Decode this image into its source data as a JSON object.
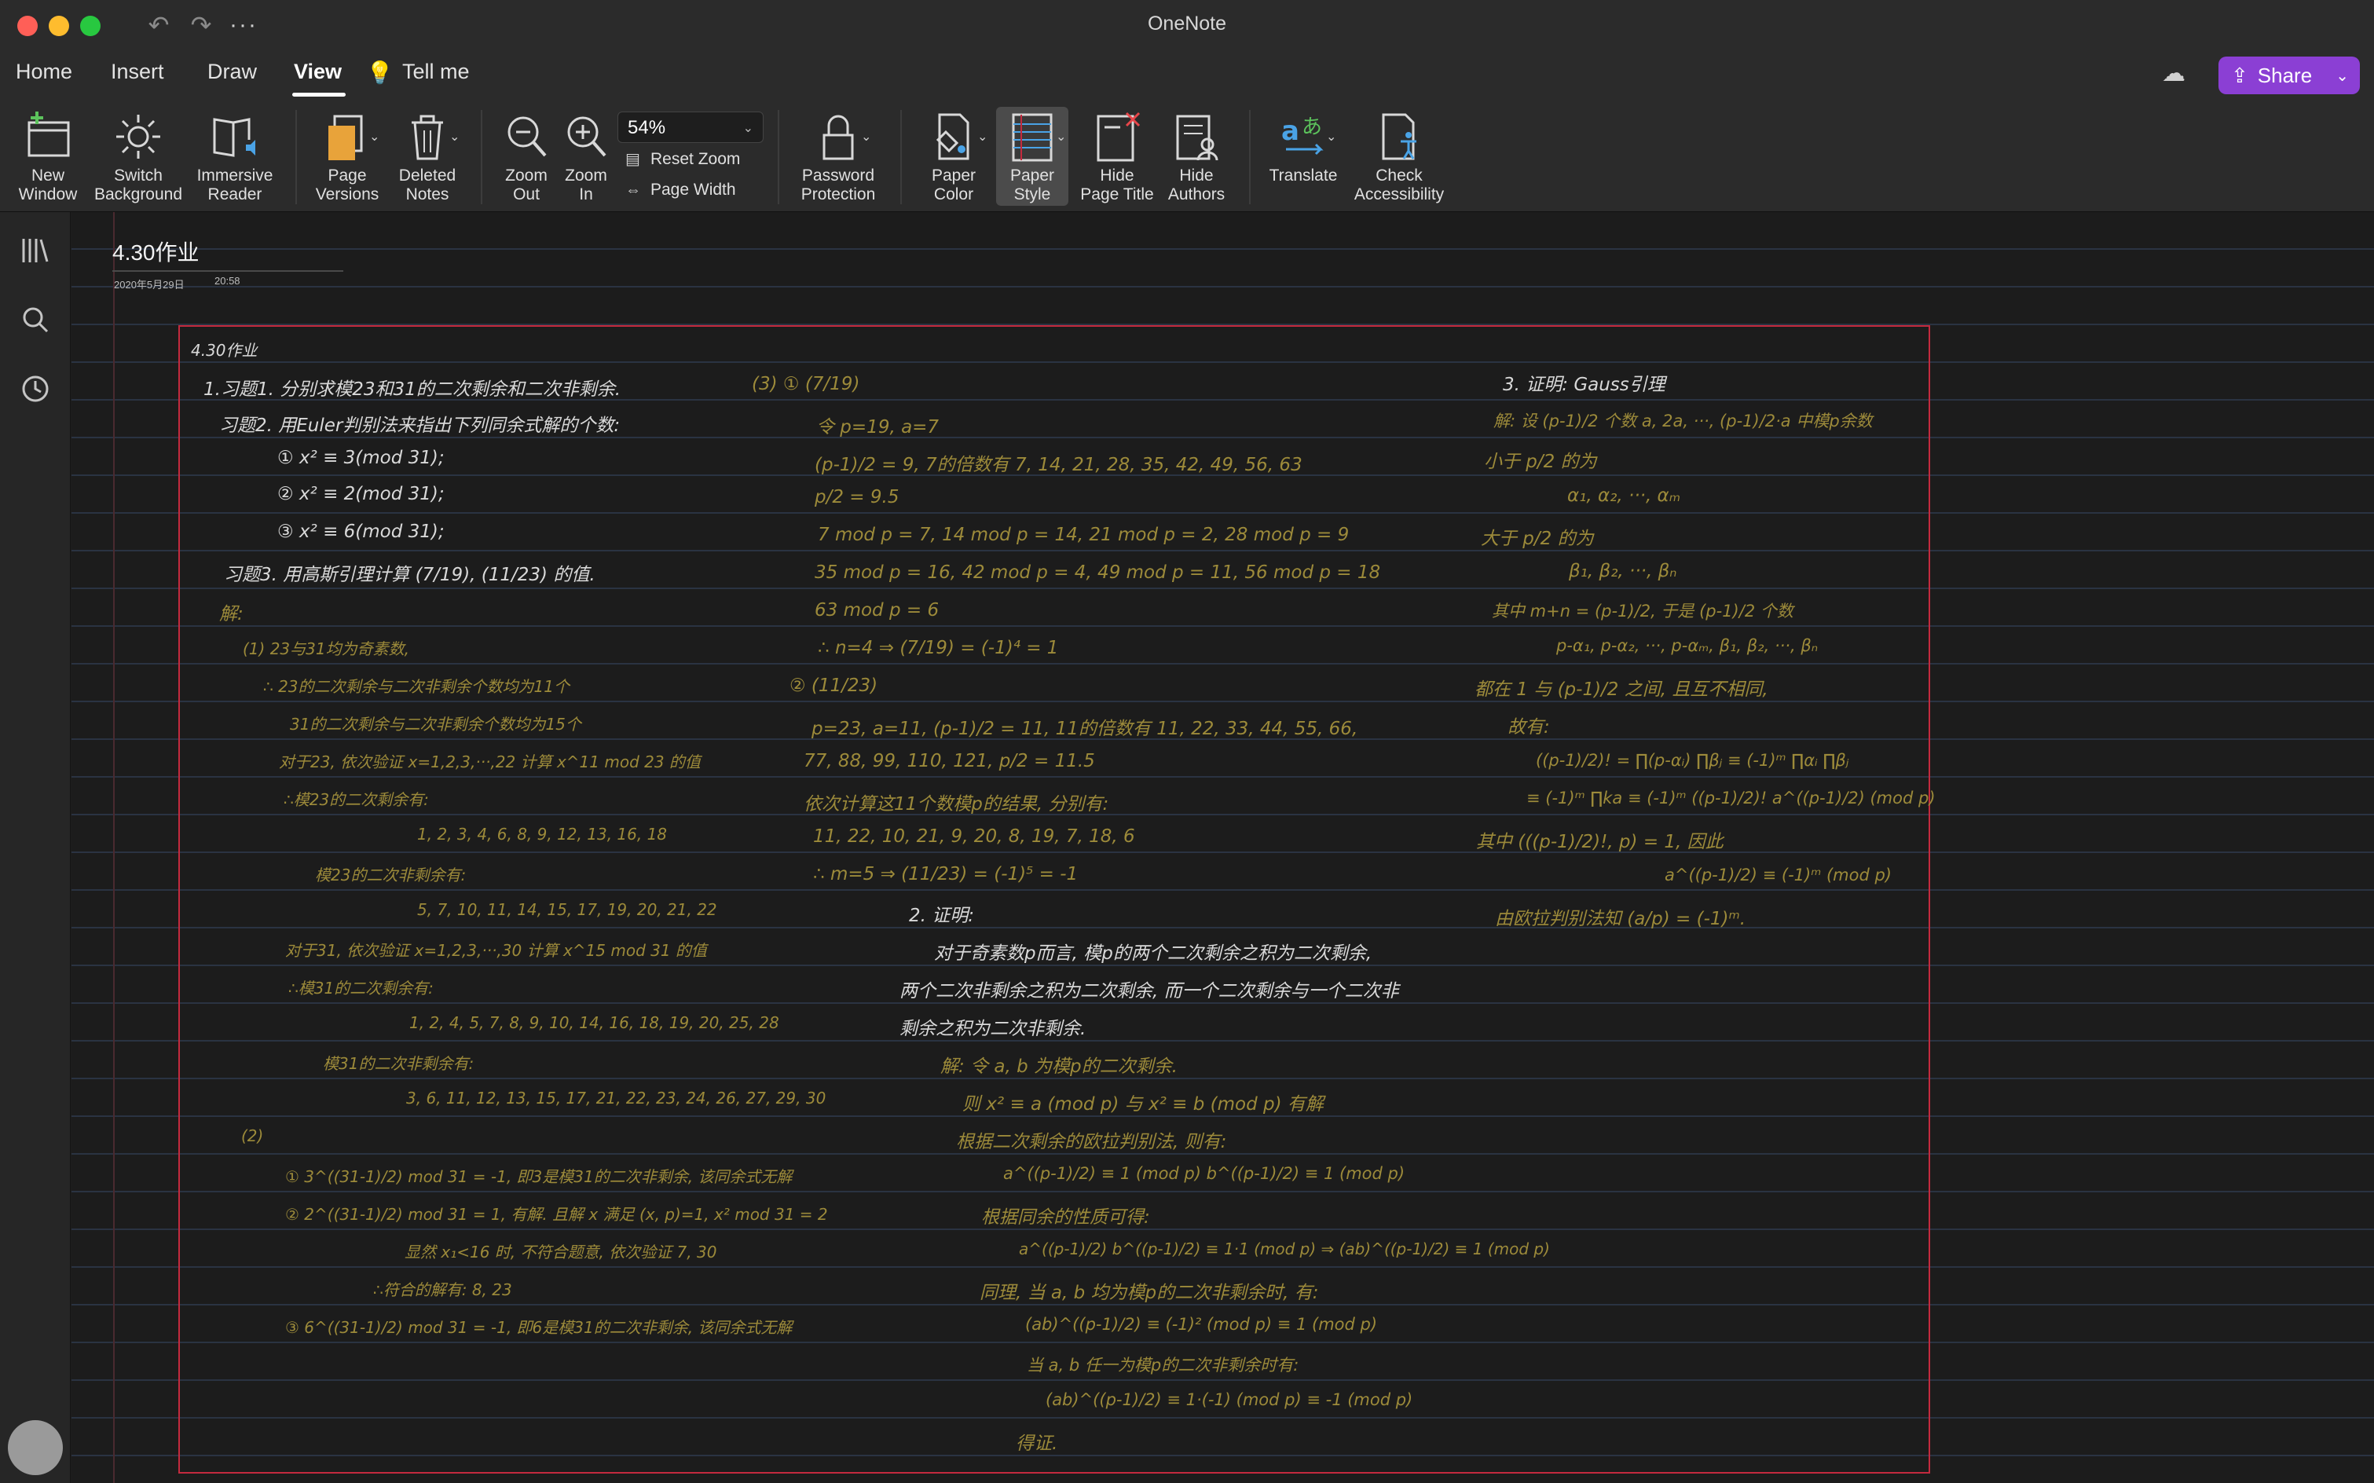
{
  "window": {
    "title": "OneNote",
    "more_label": "···"
  },
  "menu": {
    "tabs": [
      "Home",
      "Insert",
      "Draw",
      "View",
      "Tell me"
    ],
    "active": "View",
    "share_label": "Share"
  },
  "ribbon": {
    "new_window": "New\nWindow",
    "switch_background": "Switch\nBackground",
    "immersive_reader": "Immersive\nReader",
    "page_versions": "Page\nVersions",
    "deleted_notes": "Deleted\nNotes",
    "zoom_out": "Zoom\nOut",
    "zoom_in": "Zoom\nIn",
    "zoom_value": "54%",
    "reset_zoom": "Reset Zoom",
    "page_width": "Page Width",
    "password_protection": "Password\nProtection",
    "paper_color": "Paper\nColor",
    "paper_style": "Paper\nStyle",
    "hide_page_title": "Hide\nPage Title",
    "hide_authors": "Hide\nAuthors",
    "translate": "Translate",
    "check_accessibility": "Check\nAccessibility"
  },
  "page": {
    "title": "4.30作业",
    "date": "2020年5月29日",
    "time": "20:58"
  },
  "ink": {
    "col1": [
      "4.30作业",
      "1.习题1. 分别求模23和31的二次剩余和二次非剩余.",
      "习题2. 用Euler判别法来指出下列同余式解的个数:",
      "① x² ≡ 3(mod 31);",
      "② x² ≡ 2(mod 31);",
      "③ x² ≡ 6(mod 31);",
      "习题3. 用高斯引理计算 (7/19), (11/23) 的值.",
      "解:",
      "(1) 23与31均为奇素数,",
      "∴ 23的二次剩余与二次非剩余个数均为11个",
      "31的二次剩余与二次非剩余个数均为15个",
      "对于23, 依次验证 x=1,2,3,···,22 计算 x^11 mod 23 的值",
      "∴模23的二次剩余有:",
      "1, 2, 3, 4, 6, 8, 9, 12, 13, 16, 18",
      "模23的二次非剩余有:",
      "5, 7, 10, 11, 14, 15, 17, 19, 20, 21, 22",
      "对于31, 依次验证 x=1,2,3,···,30 计算 x^15 mod 31 的值",
      "∴模31的二次剩余有:",
      "1, 2, 4, 5, 7, 8, 9, 10, 14, 16, 18, 19, 20, 25, 28",
      "模31的二次非剩余有:",
      "3, 6, 11, 12, 13, 15, 17, 21, 22, 23, 24, 26, 27, 29, 30",
      "(2)",
      "① 3^((31-1)/2) mod 31 = -1, 即3是模31的二次非剩余, 该同余式无解",
      "② 2^((31-1)/2) mod 31 = 1, 有解. 且解 x 满足 (x, p)=1, x² mod 31 = 2",
      "显然 x₁<16 时, 不符合题意, 依次验证 7, 30",
      "∴符合的解有: 8, 23",
      "③ 6^((31-1)/2) mod 31 = -1, 即6是模31的二次非剩余, 该同余式无解"
    ],
    "col2": [
      "(3) ① (7/19)",
      "令 p=19, a=7",
      "(p-1)/2 = 9, 7的倍数有 7, 14, 21, 28, 35, 42, 49, 56, 63",
      "p/2 = 9.5",
      "7 mod p = 7, 14 mod p = 14, 21 mod p = 2, 28 mod p = 9",
      "35 mod p = 16, 42 mod p = 4, 49 mod p = 11, 56 mod p = 18",
      "63 mod p = 6",
      "∴ n=4 ⇒ (7/19) = (-1)⁴ = 1",
      "② (11/23)",
      "p=23, a=11, (p-1)/2 = 11, 11的倍数有 11, 22, 33, 44, 55, 66,",
      "77, 88, 99, 110, 121, p/2 = 11.5",
      "依次计算这11个数模p的结果, 分别有:",
      "11, 22, 10, 21, 9, 20, 8, 19, 7, 18, 6",
      "∴ m=5 ⇒ (11/23) = (-1)⁵ = -1",
      "2. 证明:",
      "对于奇素数p而言, 模p的两个二次剩余之积为二次剩余,",
      "两个二次非剩余之积为二次剩余, 而一个二次剩余与一个二次非",
      "剩余之积为二次非剩余.",
      "解: 令 a, b 为模p的二次剩余.",
      "则 x² ≡ a (mod p) 与 x² ≡ b (mod p) 有解",
      "根据二次剩余的欧拉判别法, 则有:",
      "a^((p-1)/2) ≡ 1 (mod p)    b^((p-1)/2) ≡ 1 (mod p)",
      "根据同余的性质可得:",
      "a^((p-1)/2) b^((p-1)/2) ≡ 1·1 (mod p) ⇒ (ab)^((p-1)/2) ≡ 1 (mod p)",
      "同理, 当 a, b 均为模p的二次非剩余时, 有:",
      "(ab)^((p-1)/2) ≡ (-1)² (mod p) ≡ 1 (mod p)",
      "当 a, b 任一为模p的二次非剩余时有:",
      "(ab)^((p-1)/2) ≡ 1·(-1) (mod p) ≡ -1 (mod p)",
      "得证."
    ],
    "col3": [
      "3. 证明: Gauss引理",
      "解: 设 (p-1)/2 个数 a, 2a, ···, (p-1)/2·a 中模p余数",
      "小于 p/2 的为",
      "α₁, α₂, ···, αₘ",
      "大于 p/2 的为",
      "β₁, β₂, ···, βₙ",
      "其中 m+n = (p-1)/2, 于是 (p-1)/2 个数",
      "p-α₁, p-α₂, ···, p-αₘ, β₁, β₂, ···, βₙ",
      "都在 1 与 (p-1)/2 之间, 且互不相同,",
      "故有:",
      "((p-1)/2)! = ∏(p-αᵢ) ∏βⱼ ≡ (-1)ᵐ ∏αᵢ ∏βⱼ",
      "≡ (-1)ᵐ ∏ka ≡ (-1)ᵐ ((p-1)/2)! a^((p-1)/2) (mod p)",
      "其中 (((p-1)/2)!, p) = 1, 因此",
      "a^((p-1)/2) ≡ (-1)ᵐ (mod p)",
      "由欧拉判别法知 (a/p) = (-1)ᵐ."
    ]
  }
}
